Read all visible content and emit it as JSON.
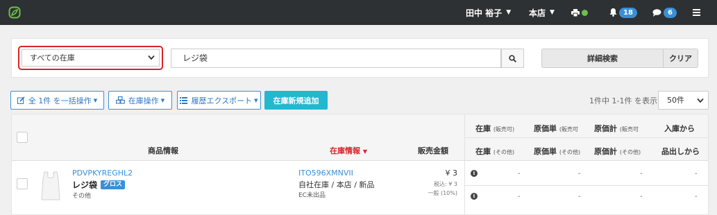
{
  "topbar": {
    "user_name": "田中 裕子",
    "store": "本店",
    "notifications_count": "18",
    "messages_count": "6",
    "icons": [
      "logo-icon",
      "printer-icon",
      "bell-icon",
      "chat-icon",
      "hamburger-icon"
    ],
    "status_color": "#6cc04a"
  },
  "search": {
    "scope_selected": "すべての在庫",
    "query": "レジ袋",
    "advanced_label": "詳細検索",
    "clear_label": "クリア"
  },
  "toolbar": {
    "bulk_label": "全 1件 を一括操作",
    "stock_label": "在庫操作",
    "export_label": "履歴エクスポート",
    "add_label": "在庫新規追加",
    "result_count": "1件中 1-1件 を表示",
    "per_page": "50件"
  },
  "table": {
    "headers": {
      "product_info": "商品情報",
      "stock_info": "在庫情報",
      "sale_price": "販売金額",
      "stock": "在庫",
      "stock_sub1": "(販売可)",
      "stock_sub2": "(その他)",
      "unit_cost": "原価単",
      "unit_cost_sub1": "(販売可",
      "unit_cost_sub2": "(その他)",
      "total_cost": "原価計",
      "total_cost_sub1": "(販売可",
      "total_cost_sub2": "(その他)",
      "since_in": "入庫から",
      "since_out": "品出しから"
    },
    "rows": [
      {
        "sku": "PDVPKYREGHL2",
        "name": "レジ袋",
        "badge": "グロス",
        "category": "その他",
        "stock_code": "ITO596XMNVII",
        "stock_info": "自社在庫 / 本店 / 新品",
        "ec_status": "EC未出品",
        "price": "¥ 3",
        "tax_in": "税込: ¥ 3",
        "tax_rate": "一般 (10%)",
        "dash": "-"
      }
    ]
  },
  "colors": {
    "accent": "#3a8fd6",
    "add_button": "#22b8cf",
    "highlight": "#d8232a",
    "topbar_bg": "#2e3133"
  }
}
